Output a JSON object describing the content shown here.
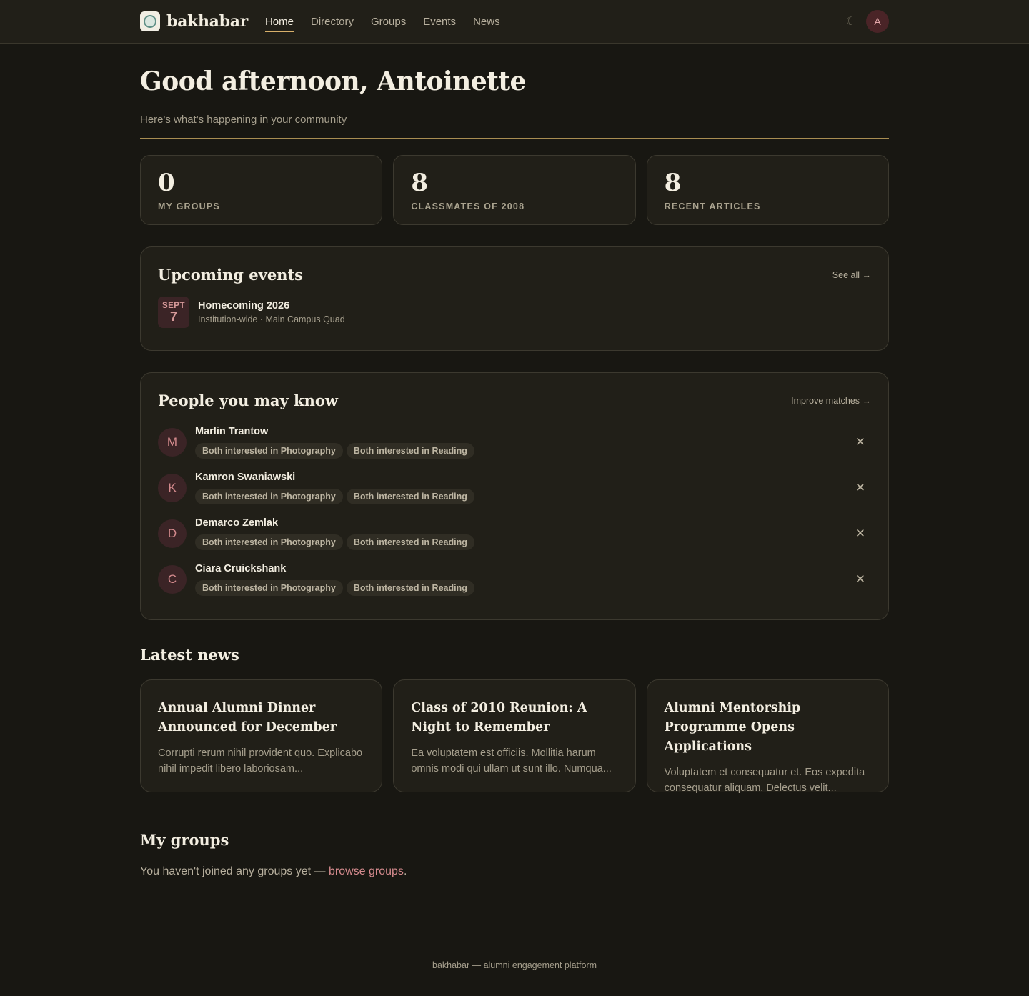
{
  "brand": {
    "name": "bakhabar",
    "logo_icon": "university-seal-icon"
  },
  "nav": {
    "items": [
      {
        "label": "Home",
        "active": true
      },
      {
        "label": "Directory",
        "active": false
      },
      {
        "label": "Groups",
        "active": false
      },
      {
        "label": "Events",
        "active": false
      },
      {
        "label": "News",
        "active": false
      }
    ],
    "theme_toggle": "☾",
    "avatar_initial": "A"
  },
  "hero": {
    "greeting": "Good afternoon, Antoinette",
    "subtitle": "Here's what's happening in your community"
  },
  "stats": [
    {
      "value": "0",
      "label": "MY GROUPS"
    },
    {
      "value": "8",
      "label": "CLASSMATES OF 2008"
    },
    {
      "value": "8",
      "label": "RECENT ARTICLES"
    }
  ],
  "events": {
    "title": "Upcoming events",
    "link": "See all →",
    "items": [
      {
        "month": "SEPT",
        "day": "7",
        "title": "Homecoming 2026",
        "meta": "Institution-wide · Main Campus Quad"
      }
    ]
  },
  "people": {
    "title": "People you may know",
    "link": "Improve matches →",
    "items": [
      {
        "initial": "M",
        "name": "Marlin Trantow",
        "tags": [
          "Both interested in Photography",
          "Both interested in Reading"
        ]
      },
      {
        "initial": "K",
        "name": "Kamron Swaniawski",
        "tags": [
          "Both interested in Photography",
          "Both interested in Reading"
        ]
      },
      {
        "initial": "D",
        "name": "Demarco Zemlak",
        "tags": [
          "Both interested in Photography",
          "Both interested in Reading"
        ]
      },
      {
        "initial": "C",
        "name": "Ciara Cruickshank",
        "tags": [
          "Both interested in Photography",
          "Both interested in Reading"
        ]
      }
    ],
    "dismiss": "✕"
  },
  "news": {
    "title": "Latest news",
    "items": [
      {
        "title": "Annual Alumni Dinner Announced for December",
        "excerpt": "Corrupti rerum nihil provident quo. Explicabo nihil impedit libero laboriosam..."
      },
      {
        "title": "Class of 2010 Reunion: A Night to Remember",
        "excerpt": "Ea voluptatem est officiis. Mollitia harum omnis modi qui ullam ut sunt illo. Numqua..."
      },
      {
        "title": "Alumni Mentorship Programme Opens Applications",
        "excerpt": "Voluptatem et consequatur et. Eos expedita consequatur aliquam. Delectus velit..."
      }
    ]
  },
  "groups": {
    "title": "My groups",
    "empty_text": "You haven't joined any groups yet — ",
    "link": "browse groups",
    "end": "."
  },
  "footer": {
    "text": "bakhabar — alumni engagement platform"
  },
  "colors": {
    "accent": "#d8b06a",
    "rose": "#d48a8d",
    "background": "#181712",
    "card": "#211f18"
  }
}
